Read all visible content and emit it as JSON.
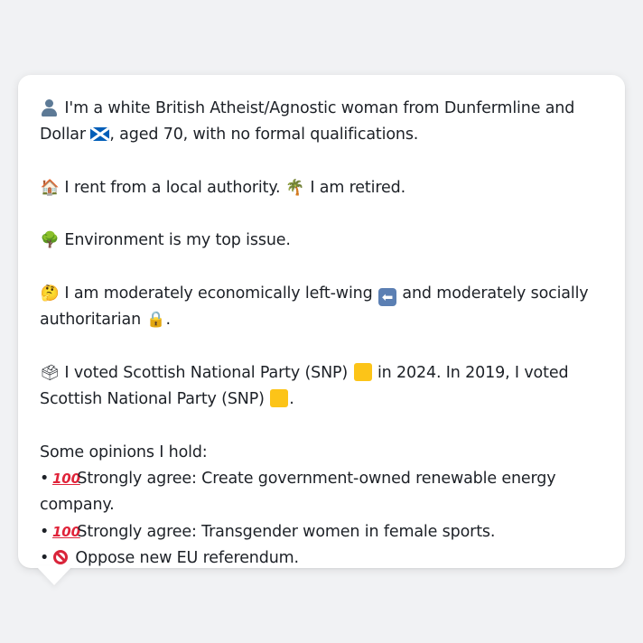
{
  "profile": {
    "line1_text": "I'm a white British Atheist/Agnostic woman from Dunfermline and Dollar",
    "line1_cont": ", aged 70, with no formal qualifications.",
    "housing_text": "I rent from a local authority.",
    "work_text": "I am retired.",
    "issue_text": "Environment is my top issue.",
    "politics_text_1": "I am moderately economically left-wing",
    "politics_text_2": "and moderately socially authoritarian",
    "politics_end": ".",
    "vote_text_1": "I voted Scottish National Party (SNP)",
    "vote_text_2": "in 2024. In 2019, I voted Scottish National Party (SNP)",
    "vote_end": ".",
    "opinions_heading": "Some opinions I hold:",
    "opinions": [
      {
        "bullet": "•",
        "icon": "hundred-points-icon",
        "text": "Strongly agree: Create government-owned renewable energy company."
      },
      {
        "bullet": "•",
        "icon": "hundred-points-icon",
        "text": "Strongly agree: Transgender women in female sports."
      },
      {
        "bullet": "•",
        "icon": "prohibited-icon",
        "text": "Oppose new EU referendum."
      }
    ]
  },
  "icons": {
    "person": "person-silhouette-icon",
    "flag": "scotland-flag-icon",
    "house": "house-icon",
    "palm": "palm-tree-icon",
    "tree": "deciduous-tree-icon",
    "thinking": "thinking-face-icon",
    "left_arrow": "left-arrow-icon",
    "lock": "lock-icon",
    "ballot": "ballot-box-icon",
    "party_color": "yellow-square-icon"
  },
  "colors": {
    "background": "#f1f2f4",
    "card": "#ffffff",
    "text": "#1d2127",
    "snp_yellow": "#fcc418"
  }
}
